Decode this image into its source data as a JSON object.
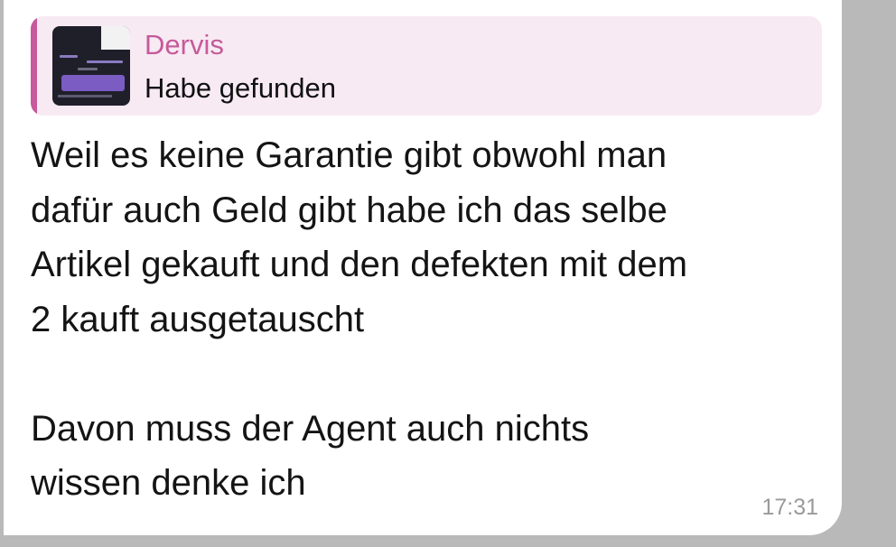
{
  "reply": {
    "sender": "Dervis",
    "text": "Habe gefunden",
    "thumbnail": "screenshot-thumbnail"
  },
  "message": {
    "paragraphs": [
      [
        "Weil es keine Garantie gibt obwohl man",
        "dafür auch Geld gibt habe ich das selbe",
        "Artikel gekauft und den defekten mit dem",
        "2 kauft ausgetauscht"
      ],
      [
        "Davon muss der Agent auch nichts",
        "wissen denke ich"
      ]
    ],
    "time": "17:31"
  },
  "colors": {
    "accent": "#c65a9a",
    "reply_background": "#f7eaf3",
    "bubble": "#ffffff",
    "page_background": "#b9b9b9",
    "timestamp": "#9a9a9a"
  }
}
